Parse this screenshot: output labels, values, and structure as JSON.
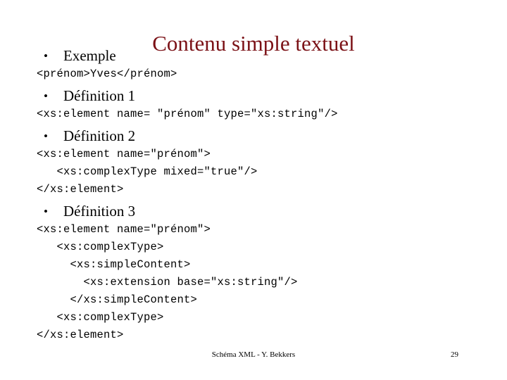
{
  "slide": {
    "title": "Contenu simple textuel",
    "title_color": "#7b1116",
    "background_color": "#ffffff",
    "text_color": "#000000"
  },
  "blocks": [
    {
      "bullet_label": "Exemple",
      "bullet_marker": "•",
      "code_lines": [
        "<prénom>Yves</prénom>"
      ]
    },
    {
      "bullet_label": "Définition 1",
      "bullet_marker": "•",
      "code_lines": [
        "<xs:element name= \"prénom\" type=\"xs:string\"/>"
      ]
    },
    {
      "bullet_label": "Définition 2",
      "bullet_marker": "•",
      "code_lines": [
        "<xs:element name=\"prénom\">",
        "   <xs:complexType mixed=\"true\"/>",
        "</xs:element>"
      ]
    },
    {
      "bullet_label": "Définition 3",
      "bullet_marker": "•",
      "code_lines": [
        "<xs:element name=\"prénom\">",
        "   <xs:complexType>",
        "     <xs:simpleContent>",
        "       <xs:extension base=\"xs:string\"/>",
        "     </xs:simpleContent>",
        "   <xs:complexType>",
        "</xs:element>"
      ]
    }
  ],
  "footer": {
    "text": "Schéma XML - Y. Bekkers",
    "page_number": "29"
  }
}
